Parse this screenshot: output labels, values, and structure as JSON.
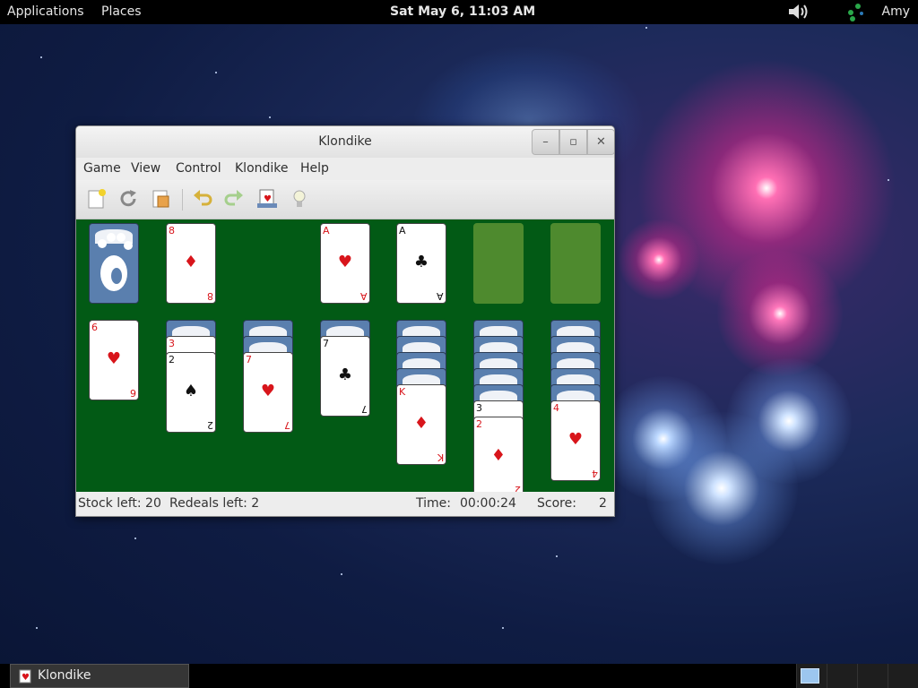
{
  "topbar": {
    "applications": "Applications",
    "places": "Places",
    "clock": "Sat May  6, 11:03 AM",
    "user": "Amy",
    "icons": [
      "volume-icon",
      "network-icon"
    ]
  },
  "window": {
    "title": "Klondike",
    "controls": [
      "minimize",
      "maximize",
      "close"
    ],
    "menu": [
      "Game",
      "View",
      "Control",
      "Klondike",
      "Help"
    ],
    "toolbar": [
      "new-game-icon",
      "restart-icon",
      "select-game-icon",
      "undo-icon",
      "redo-icon",
      "deal-icon",
      "hint-icon"
    ],
    "status": {
      "stock": "Stock left: 20",
      "redeals": "Redeals left: 2",
      "time_label": "Time:",
      "time": "00:00:24",
      "score_label": "Score:",
      "score": "2"
    }
  },
  "game": {
    "stock": "face-down",
    "waste": {
      "rank": "8",
      "suit": "♦"
    },
    "foundations": [
      {
        "rank": "A",
        "suit": "♥"
      },
      {
        "rank": "A",
        "suit": "♣"
      },
      null,
      null
    ],
    "tableau": [
      {
        "hidden": 0,
        "cards": [
          {
            "rank": "6",
            "suit": "♥"
          }
        ]
      },
      {
        "hidden": 1,
        "cards": [
          {
            "rank": "3",
            "suit": "♥"
          },
          {
            "rank": "2",
            "suit": "♠"
          }
        ]
      },
      {
        "hidden": 2,
        "cards": [
          {
            "rank": "7",
            "suit": "♥"
          }
        ]
      },
      {
        "hidden": 1,
        "cards": [
          {
            "rank": "7",
            "suit": "♣"
          }
        ]
      },
      {
        "hidden": 4,
        "cards": [
          {
            "rank": "K",
            "suit": "♦"
          }
        ]
      },
      {
        "hidden": 5,
        "cards": [
          {
            "rank": "3",
            "suit": "♣"
          },
          {
            "rank": "2",
            "suit": "♦"
          }
        ]
      },
      {
        "hidden": 5,
        "cards": [
          {
            "rank": "4",
            "suit": "♥"
          }
        ]
      }
    ]
  },
  "taskbar": {
    "task_label": "Klondike"
  },
  "colors": {
    "felt": "#025a15",
    "empty_slot": "#4e8a2e",
    "card_back": "#5a7fae"
  }
}
